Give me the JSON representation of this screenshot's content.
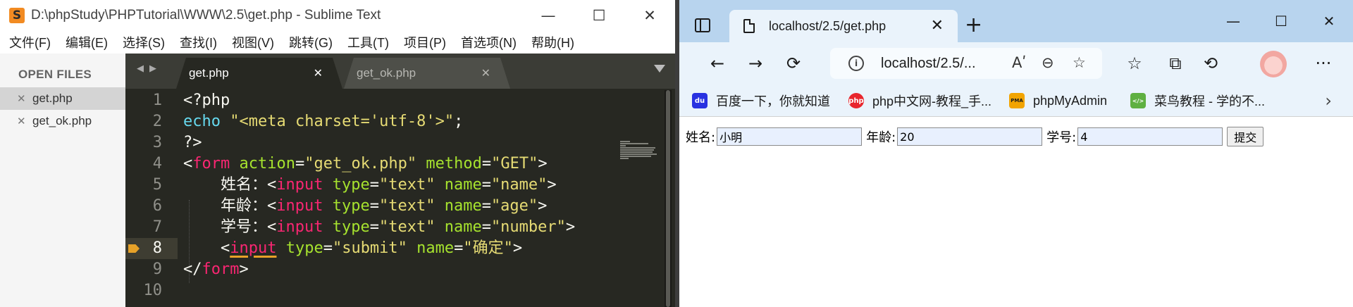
{
  "sublime": {
    "title": "D:\\phpStudy\\PHPTutorial\\WWW\\2.5\\get.php - Sublime Text",
    "logo": "S",
    "window_controls": {
      "minimize": "—",
      "maximize": "☐",
      "close": "✕"
    },
    "menu": [
      "文件(F)",
      "编辑(E)",
      "选择(S)",
      "查找(I)",
      "视图(V)",
      "跳转(G)",
      "工具(T)",
      "项目(P)",
      "首选项(N)",
      "帮助(H)"
    ],
    "sidebar": {
      "header": "OPEN FILES",
      "files": [
        {
          "name": "get.php",
          "active": true
        },
        {
          "name": "get_ok.php",
          "active": false
        }
      ]
    },
    "tabs": [
      {
        "label": "get.php",
        "active": true
      },
      {
        "label": "get_ok.php",
        "active": false
      }
    ],
    "line_numbers": [
      "1",
      "2",
      "3",
      "4",
      "5",
      "6",
      "7",
      "8",
      "9",
      "10"
    ],
    "current_line": 8,
    "code": {
      "l1": "<?php",
      "l2": {
        "kw": "echo",
        "str": "\"<meta charset='utf-8'>\"",
        "end": ";"
      },
      "l3": "?>",
      "l4": {
        "open": "<",
        "tag": "form",
        "attr1": "action",
        "eq1": "=",
        "val1": "\"get_ok.php\"",
        "attr2": "method",
        "eq2": "=",
        "val2": "\"GET\"",
        "close": ">"
      },
      "l5": {
        "label": "姓名：",
        "open": "<",
        "tag": "input",
        "attr1": "type",
        "eq1": "=",
        "val1": "\"text\"",
        "attr2": "name",
        "eq2": "=",
        "val2": "\"name\"",
        "close": ">"
      },
      "l6": {
        "label": "年龄：",
        "open": "<",
        "tag": "input",
        "attr1": "type",
        "eq1": "=",
        "val1": "\"text\"",
        "attr2": "name",
        "eq2": "=",
        "val2": "\"age\"",
        "close": ">"
      },
      "l7": {
        "label": "学号：",
        "open": "<",
        "tag": "input",
        "attr1": "type",
        "eq1": "=",
        "val1": "\"text\"",
        "attr2": "name",
        "eq2": "=",
        "val2": "\"number\"",
        "close": ">"
      },
      "l8": {
        "open": "<",
        "tag": "input",
        "attr1": "type",
        "eq1": "=",
        "val1": "\"submit\"",
        "attr2": "name",
        "eq2": "=",
        "val2": "\"确定\"",
        "close": ">"
      },
      "l9": {
        "open": "</",
        "tag": "form",
        "close": ">"
      }
    },
    "colors": {
      "background": "#272822",
      "keyword": "#f92672",
      "attribute": "#a6e22e",
      "string": "#e6db74",
      "builtin": "#66d9ef",
      "bookmark": "#e6a128"
    }
  },
  "browser": {
    "tab_title": "localhost/2.5/get.php",
    "tab_close": "✕",
    "new_tab": "+",
    "window_controls": {
      "minimize": "—",
      "maximize": "☐",
      "close": "✕"
    },
    "nav": {
      "back": "←",
      "forward": "→",
      "refresh": "⟳"
    },
    "address": "localhost/2.5/...",
    "address_icons": {
      "info": "i",
      "read_aloud": "Aʹ",
      "zoom_out": "⊖",
      "favorite_add": "☆"
    },
    "toolbar_icons": {
      "favorites": "☆",
      "collections": "⧉",
      "history": "⟲",
      "more": "···"
    },
    "bookmarks": [
      {
        "label": "百度一下，你就知道",
        "icon": "du",
        "color": "#2932e1"
      },
      {
        "label": "php中文网-教程_手...",
        "icon": "php",
        "color": "#e8262d"
      },
      {
        "label": "phpMyAdmin",
        "icon": "PMA",
        "color": "#f2a400"
      },
      {
        "label": "菜鸟教程 - 学的不...",
        "icon": "</>",
        "color": "#5fb041"
      }
    ],
    "bookmarks_more": "›",
    "form": {
      "name_label": "姓名:",
      "name_value": "小明",
      "age_label": "年龄:",
      "age_value": "20",
      "number_label": "学号:",
      "number_value": "4",
      "submit_label": "提交"
    }
  }
}
